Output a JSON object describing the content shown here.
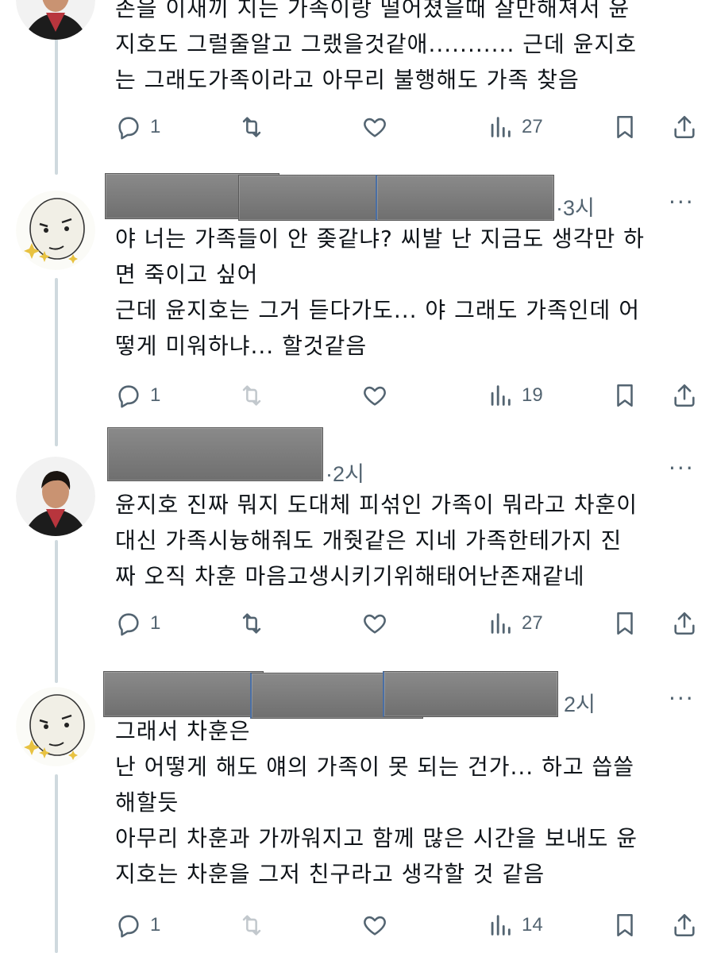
{
  "thread": {
    "posts": [
      {
        "avatar": "dark-hair-man-avatar",
        "time": "",
        "text_lines": [
          "존을 이새끼 지는 가족이랑 떨어졌을때 잘만해져서 윤",
          "지호도 그럴줄알고 그랬을것같애........... 근데 윤지호",
          "는 그래도가족이라고 아무리 불행해도 가족 찾음"
        ],
        "replies": "1",
        "retweets": "",
        "likes": "",
        "views": "27"
      },
      {
        "avatar": "cartoon-face-sparkles-avatar",
        "time": "·3시",
        "text_lines": [
          "야 너는 가족들이 안 좆같냐? 씨발 난 지금도 생각만 하",
          "면 죽이고 싶어",
          "근데 윤지호는 그거 듣다가도... 야 그래도 가족인데 어",
          "떻게 미워하냐... 할것같음"
        ],
        "replies": "1",
        "retweets": "",
        "likes": "",
        "views": "19"
      },
      {
        "avatar": "dark-hair-man-avatar",
        "time": "·2시",
        "text_lines": [
          "윤지호 진짜 뭐지 도대체 피섞인 가족이 뭐라고 차훈이",
          "대신 가족시늉해줘도 개줫같은 지네 가족한테가지 진",
          "짜 오직 차훈 마음고생시키기위해태어난존재같네"
        ],
        "replies": "1",
        "retweets": "",
        "likes": "",
        "views": "27"
      },
      {
        "avatar": "cartoon-face-sparkles-avatar",
        "time": "2시",
        "text_lines": [
          "그래서 차훈은",
          "난 어떻게 해도 얘의 가족이 못 되는 건가... 하고 씁쓸",
          "해할듯",
          "아무리 차훈과 가까워지고 함께 많은 시간을 보내도 윤",
          "지호는 차훈을 그저 친구라고 생각할 것 같음"
        ],
        "replies": "1",
        "retweets": "",
        "likes": "",
        "views": "14"
      }
    ],
    "more_label": "···"
  },
  "colors": {
    "text": "#0f1419",
    "secondary": "#536471",
    "thread_line": "#cfd9de",
    "redaction": "#7a7a7a"
  },
  "icons": [
    "reply-icon",
    "retweet-icon",
    "like-icon",
    "views-icon",
    "bookmark-icon",
    "share-icon",
    "more-icon"
  ]
}
